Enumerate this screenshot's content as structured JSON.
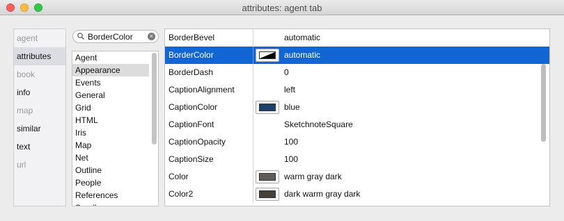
{
  "window": {
    "title": "attributes: agent tab"
  },
  "tabs": [
    {
      "label": "agent",
      "state": "disabled"
    },
    {
      "label": "attributes",
      "state": "selected"
    },
    {
      "label": "book",
      "state": "disabled"
    },
    {
      "label": "info",
      "state": "enabled"
    },
    {
      "label": "map",
      "state": "disabled"
    },
    {
      "label": "similar",
      "state": "enabled"
    },
    {
      "label": "text",
      "state": "enabled"
    },
    {
      "label": "url",
      "state": "disabled"
    }
  ],
  "search": {
    "value": "BorderColor"
  },
  "categories": [
    {
      "label": "Agent"
    },
    {
      "label": "Appearance",
      "selected": true
    },
    {
      "label": "Events"
    },
    {
      "label": "General"
    },
    {
      "label": "Grid"
    },
    {
      "label": "HTML"
    },
    {
      "label": "Iris"
    },
    {
      "label": "Map"
    },
    {
      "label": "Net"
    },
    {
      "label": "Outline"
    },
    {
      "label": "People"
    },
    {
      "label": "References"
    },
    {
      "label": "Sandbox"
    }
  ],
  "attributes": [
    {
      "name": "BorderBevel",
      "value": "automatic"
    },
    {
      "name": "BorderColor",
      "value": "automatic",
      "selected": true,
      "swatch": "automatic"
    },
    {
      "name": "BorderDash",
      "value": "0"
    },
    {
      "name": "CaptionAlignment",
      "value": "left"
    },
    {
      "name": "CaptionColor",
      "value": "blue",
      "swatch": "#1d3f6e"
    },
    {
      "name": "CaptionFont",
      "value": "SketchnoteSquare"
    },
    {
      "name": "CaptionOpacity",
      "value": "100"
    },
    {
      "name": "CaptionSize",
      "value": "100"
    },
    {
      "name": "Color",
      "value": "warm gray dark",
      "swatch": "#625c58"
    },
    {
      "name": "Color2",
      "value": "dark warm gray dark",
      "swatch": "#433f3b"
    }
  ],
  "colors": {
    "selection": "#1166d4",
    "close": "#fc605c",
    "minimize": "#fdbc40",
    "zoom": "#34c84a"
  }
}
